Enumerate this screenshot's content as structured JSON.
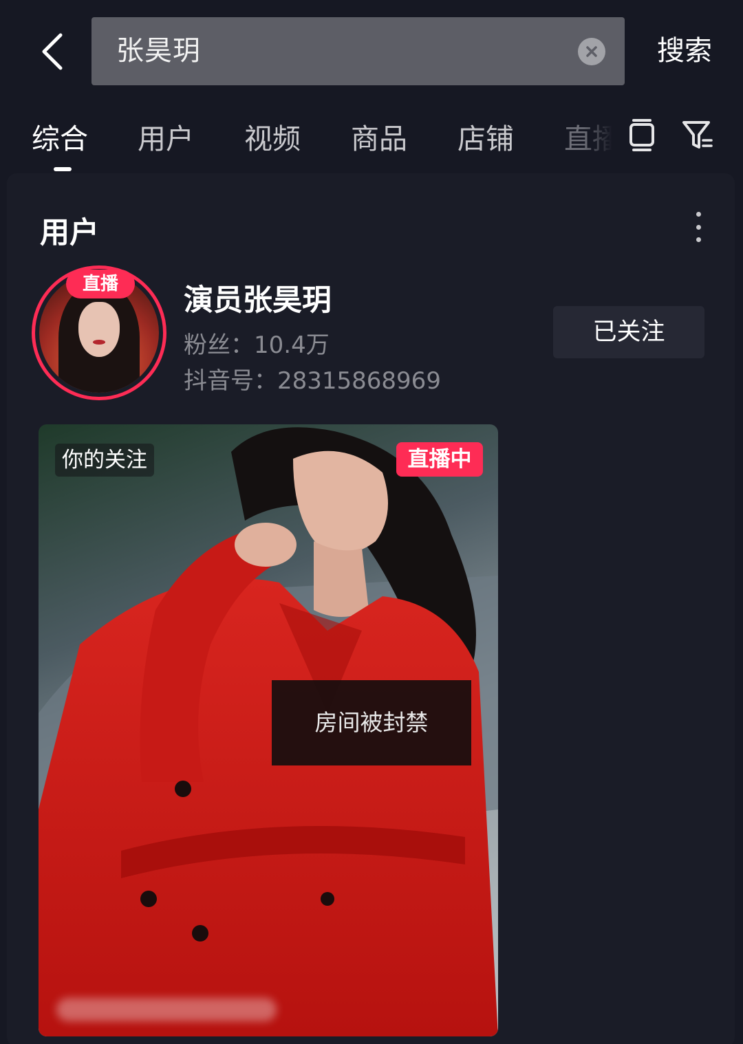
{
  "search": {
    "query": "张昊玥",
    "submit_label": "搜索"
  },
  "tabs": [
    {
      "label": "综合",
      "active": true
    },
    {
      "label": "用户",
      "active": false
    },
    {
      "label": "视频",
      "active": false
    },
    {
      "label": "商品",
      "active": false
    },
    {
      "label": "店铺",
      "active": false
    },
    {
      "label": "直播",
      "active": false
    }
  ],
  "section": {
    "title": "用户"
  },
  "user": {
    "live_badge": "直播",
    "name": "演员张昊玥",
    "followers_label": "粉丝：",
    "followers_value": "10.4万",
    "id_label": "抖音号：",
    "id_value": "28315868969",
    "follow_button": "已关注"
  },
  "live_preview": {
    "following_tag": "你的关注",
    "live_tag": "直播中",
    "status_message": "房间被封禁"
  },
  "colors": {
    "background": "#161823",
    "accent": "#fe2c55",
    "card": "#1a1c27"
  },
  "icons": [
    "back-arrow-icon",
    "clear-icon",
    "tablet-icon",
    "filter-icon",
    "more-vertical-icon"
  ]
}
